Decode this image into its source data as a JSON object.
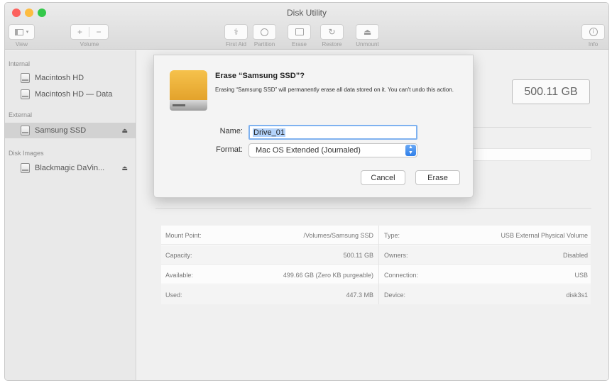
{
  "window": {
    "title": "Disk Utility"
  },
  "toolbar": {
    "view_label": "View",
    "volume_label": "Volume",
    "first_aid_label": "First Aid",
    "partition_label": "Partition",
    "erase_label": "Erase",
    "restore_label": "Restore",
    "unmount_label": "Unmount",
    "info_label": "Info"
  },
  "sidebar": {
    "sections": [
      {
        "title": "Internal",
        "items": [
          {
            "label": "Macintosh HD"
          },
          {
            "label": "Macintosh HD — Data"
          }
        ]
      },
      {
        "title": "External",
        "items": [
          {
            "label": "Samsung SSD",
            "selected": true
          }
        ]
      },
      {
        "title": "Disk Images",
        "items": [
          {
            "label": "Blackmagic DaVin..."
          }
        ]
      }
    ]
  },
  "main": {
    "capacity": "500.11 GB",
    "info": {
      "rows": [
        {
          "left_key": "Mount Point:",
          "left_val": "/Volumes/Samsung SSD",
          "right_key": "Type:",
          "right_val": "USB External Physical Volume"
        },
        {
          "left_key": "Capacity:",
          "left_val": "500.11 GB",
          "right_key": "Owners:",
          "right_val": "Disabled"
        },
        {
          "left_key": "Available:",
          "left_val": "499.66 GB (Zero KB purgeable)",
          "right_key": "Connection:",
          "right_val": "USB"
        },
        {
          "left_key": "Used:",
          "left_val": "447.3 MB",
          "right_key": "Device:",
          "right_val": "disk3s1"
        }
      ]
    }
  },
  "dialog": {
    "title": "Erase “Samsung SSD”?",
    "message": "Erasing “Samsung SSD” will permanently erase all data stored on it. You can't undo this action.",
    "name_label": "Name:",
    "name_value": "Drive_01",
    "format_label": "Format:",
    "format_value": "Mac OS Extended (Journaled)",
    "cancel_label": "Cancel",
    "erase_label": "Erase"
  },
  "colors": {
    "accent": "#2f7fe9",
    "drive_icon": "#f0b43c",
    "sidebar_bg": "#e9e9e9",
    "selected_row": "#d2d2d2"
  },
  "icons": {
    "view": "sidebar-icon",
    "volume_add": "plus-icon",
    "volume_remove": "minus-icon",
    "first_aid": "stethoscope-icon",
    "partition": "pie-icon",
    "erase": "eraser-icon",
    "restore": "restore-icon",
    "unmount": "eject-icon",
    "info": "info-icon"
  }
}
